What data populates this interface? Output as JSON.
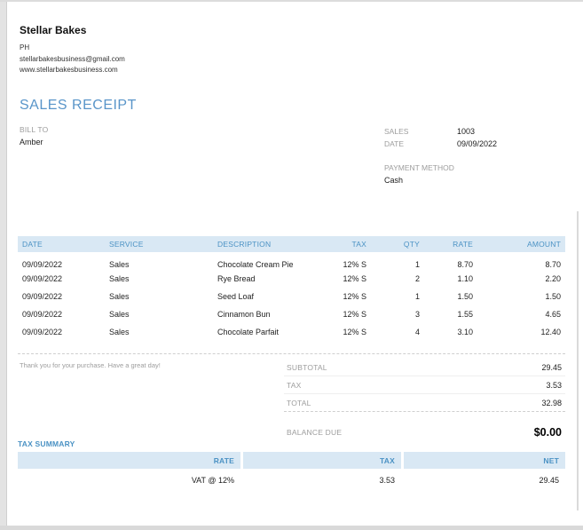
{
  "company": {
    "name": "Stellar Bakes",
    "country": "PH",
    "email": "stellarbakesbusiness@gmail.com",
    "website": "www.stellarbakesbusiness.com"
  },
  "receipt": {
    "title": "SALES RECEIPT",
    "bill_to_label": "BILL TO",
    "bill_to": "Amber",
    "meta": [
      {
        "label": "SALES",
        "value": "1003"
      },
      {
        "label": "DATE",
        "value": "09/09/2022"
      }
    ],
    "payment_method_label": "PAYMENT METHOD",
    "payment_method": "Cash"
  },
  "line_items": {
    "columns": [
      "DATE",
      "SERVICE",
      "DESCRIPTION",
      "TAX",
      "QTY",
      "RATE",
      "AMOUNT"
    ],
    "rows": [
      [
        "09/09/2022",
        "Sales",
        "Chocolate Cream Pie",
        "12% S",
        "1",
        "8.70",
        "8.70"
      ],
      [
        "09/09/2022",
        "Sales",
        "Rye Bread",
        "12% S",
        "2",
        "1.10",
        "2.20"
      ],
      [
        "09/09/2022",
        "Sales",
        "Seed Loaf",
        "12% S",
        "1",
        "1.50",
        "1.50"
      ],
      [
        "09/09/2022",
        "Sales",
        "Cinnamon Bun",
        "12% S",
        "3",
        "1.55",
        "4.65"
      ],
      [
        "09/09/2022",
        "Sales",
        "Chocolate Parfait",
        "12% S",
        "4",
        "3.10",
        "12.40"
      ]
    ]
  },
  "footer": {
    "message": "Thank you for your purchase. Have a great day!",
    "totals": [
      {
        "label": "SUBTOTAL",
        "value": "29.45"
      },
      {
        "label": "TAX",
        "value": "3.53"
      },
      {
        "label": "TOTAL",
        "value": "32.98"
      }
    ],
    "balance_due_label": "BALANCE DUE",
    "balance_due": "$0.00"
  },
  "tax_summary": {
    "title": "TAX SUMMARY",
    "columns": [
      "RATE",
      "TAX",
      "NET"
    ],
    "rows": [
      [
        "VAT @ 12%",
        "3.53",
        "29.45"
      ]
    ]
  },
  "colors": {
    "accent_blue": "#4b92c4",
    "title_blue": "#5995c9",
    "table_header_bg": "#d9e8f4",
    "label_gray": "#9d9d9d"
  }
}
